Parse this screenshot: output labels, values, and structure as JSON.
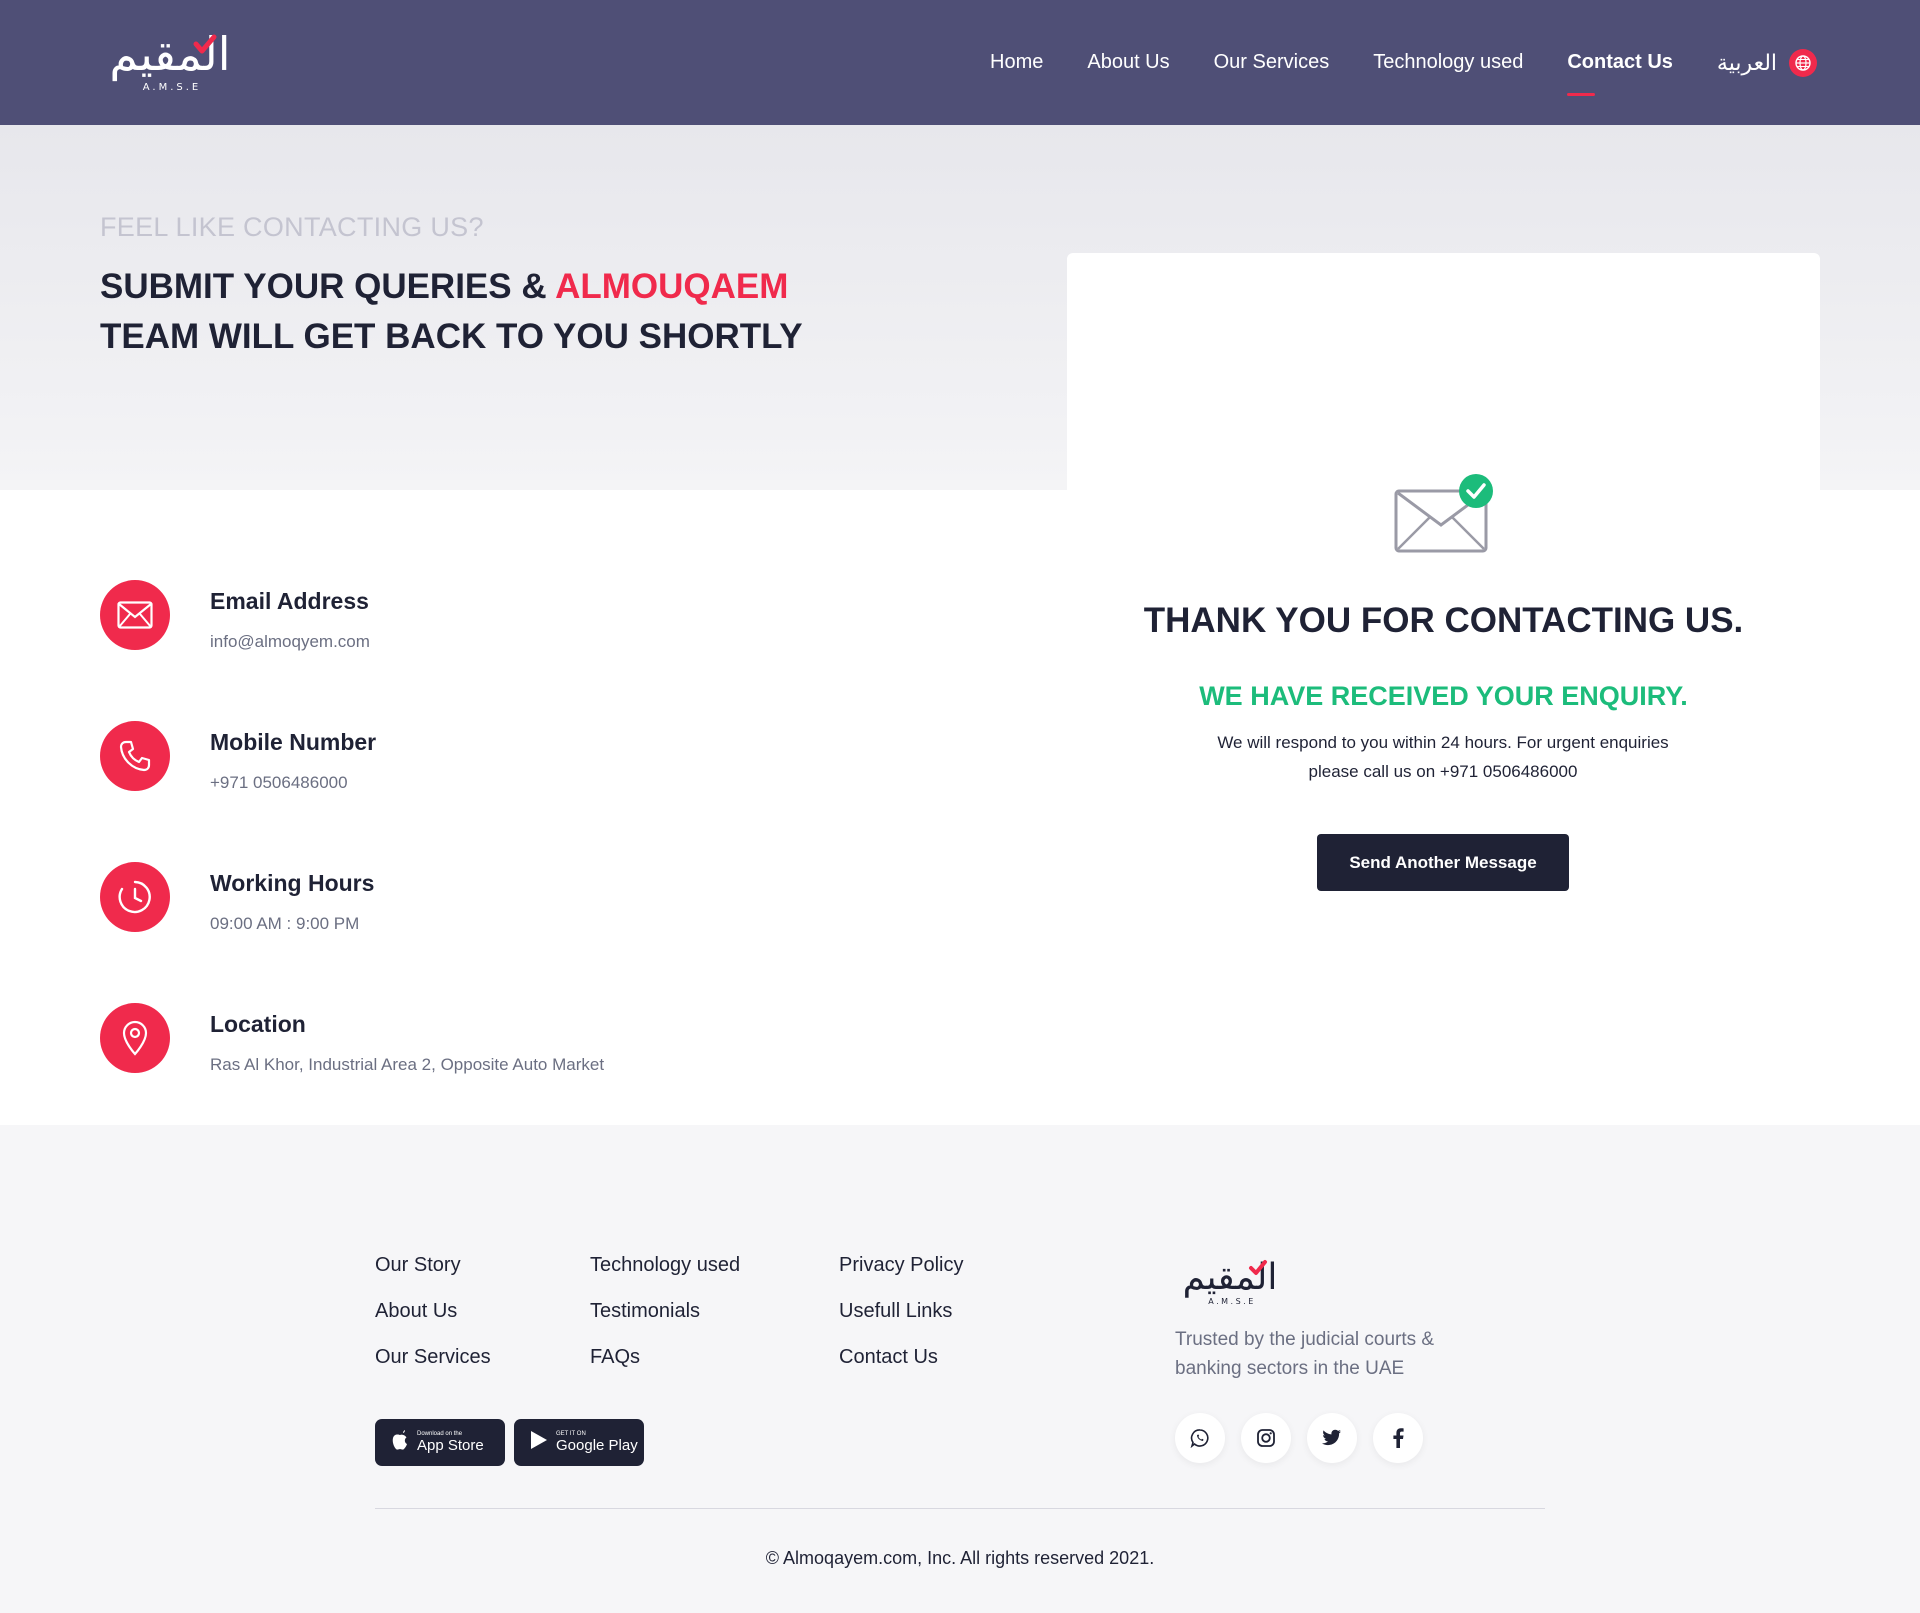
{
  "brand": {
    "logo_text": "المقيم",
    "logo_sub": "A.M.S.E",
    "accent": "#f02a4c",
    "header_bg": "#4f4f76",
    "dark": "#1f2235",
    "success": "#1cbc7b"
  },
  "nav": {
    "items": [
      {
        "label": "Home"
      },
      {
        "label": "About Us"
      },
      {
        "label": "Our Services"
      },
      {
        "label": "Technology used"
      },
      {
        "label": "Contact Us",
        "active": true
      }
    ],
    "language": "العربية",
    "language_icon": "globe-icon"
  },
  "hero": {
    "eyebrow": "FEEL LIKE CONTACTING US?",
    "headline_before": "SUBMIT YOUR QUERIES & ",
    "headline_accent": "ALMOUQAEM",
    "headline_after": " TEAM WILL GET BACK TO YOU SHORTLY"
  },
  "contact": [
    {
      "title": "Email Address",
      "value": "info@almoqyem.com",
      "icon": "envelope-icon"
    },
    {
      "title": "Mobile Number",
      "value": "+971 0506486000",
      "icon": "phone-icon"
    },
    {
      "title": "Working Hours",
      "value": "09:00 AM : 9:00 PM",
      "icon": "clock-icon"
    },
    {
      "title": "Location",
      "value": "Ras Al Khor, Industrial Area 2, Opposite Auto Market",
      "icon": "location-pin-icon"
    }
  ],
  "success": {
    "icon": "mail-check-icon",
    "title": "THANK YOU FOR CONTACTING US.",
    "subtitle": "WE HAVE RECEIVED YOUR ENQUIRY.",
    "line1": "We will respond to you within 24 hours.  For urgent enquiries",
    "line2": "please call us on +971 0506486000",
    "button": "Send Another Message"
  },
  "footer": {
    "col1": [
      "Our Story",
      "About Us",
      "Our Services"
    ],
    "col2": [
      "Technology used",
      "Testimonials",
      "FAQs"
    ],
    "col3": [
      "Privacy Policy",
      "Usefull Links",
      "Contact Us"
    ],
    "app_store": {
      "small": "Download on the",
      "big": "App Store"
    },
    "google_play": {
      "small": "GET IT ON",
      "big": "Google Play"
    },
    "logo_text": "المقيم",
    "logo_sub": "A.M.S.E",
    "tagline": "Trusted by the judicial courts & banking sectors in the UAE",
    "social": [
      "whatsapp-icon",
      "instagram-icon",
      "twitter-icon",
      "facebook-icon"
    ],
    "copyright": "© Almoqayem.com, Inc. All rights reserved 2021."
  }
}
